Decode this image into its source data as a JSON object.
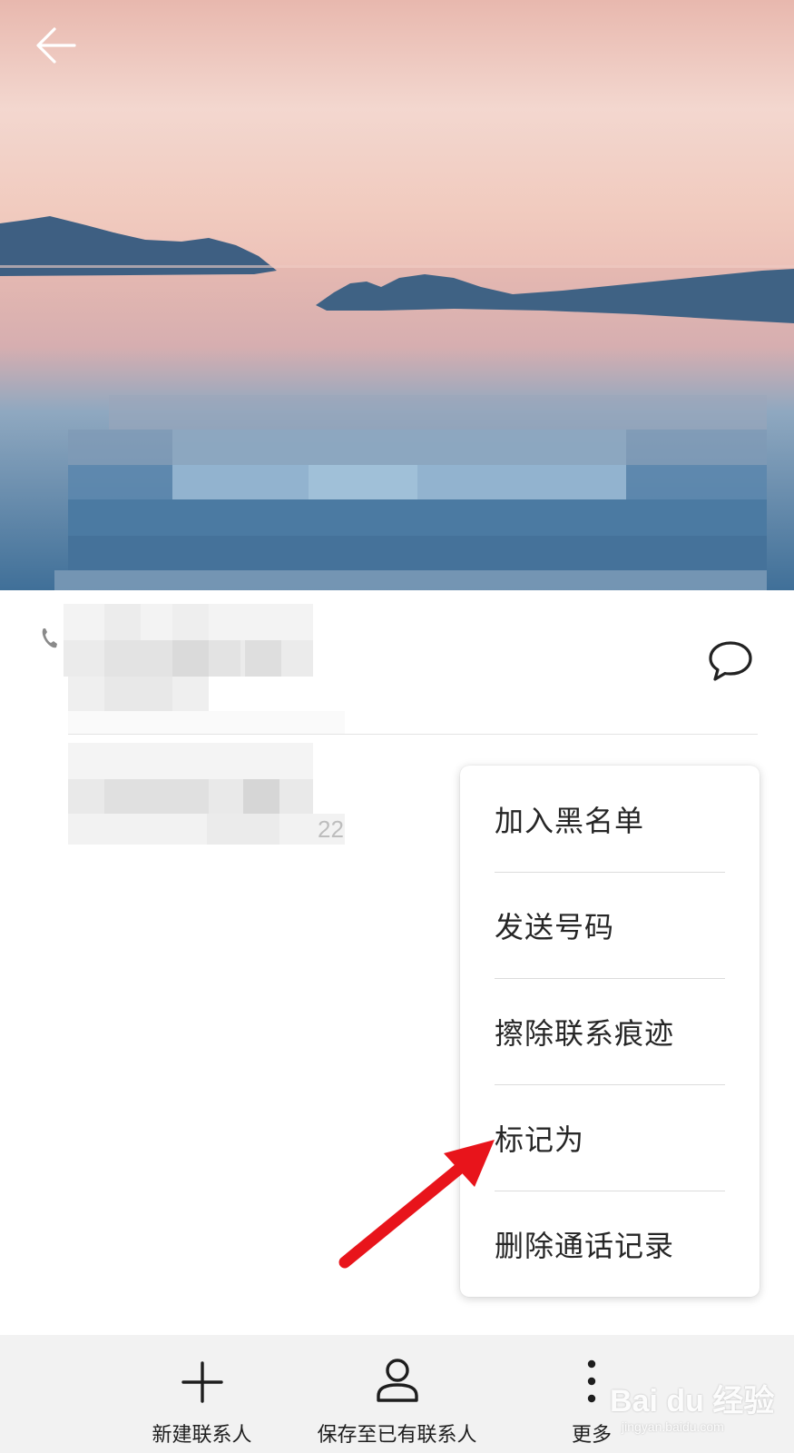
{
  "header": {
    "back_icon": "arrow-left-icon"
  },
  "contact": {
    "partial_number_suffix": "22",
    "message_icon": "message-bubble-icon"
  },
  "menu": {
    "items": [
      {
        "label": "加入黑名单"
      },
      {
        "label": "发送号码"
      },
      {
        "label": "擦除联系痕迹"
      },
      {
        "label": "标记为"
      },
      {
        "label": "删除通话记录"
      }
    ]
  },
  "toolbar": {
    "buttons": [
      {
        "label": "新建联系人",
        "icon": "plus-icon"
      },
      {
        "label": "保存至已有联系人",
        "icon": "person-icon"
      },
      {
        "label": "更多",
        "icon": "more-vertical-icon"
      }
    ]
  },
  "watermark": {
    "logo_text": "Bai du 经验",
    "url": "jingyan.baidu.com"
  },
  "annotation": {
    "arrow_color": "#e8141b"
  }
}
